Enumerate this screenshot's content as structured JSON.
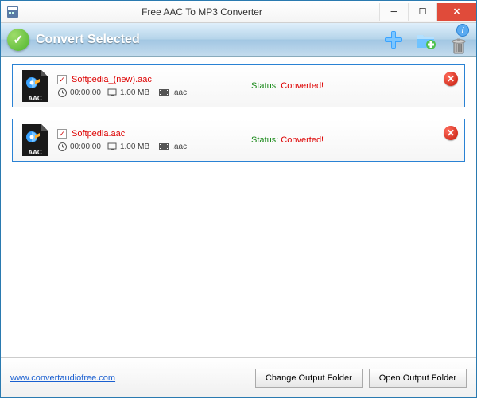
{
  "window": {
    "title": "Free AAC To MP3 Converter"
  },
  "toolbar": {
    "convert_label": "Convert Selected"
  },
  "files": [
    {
      "name": "Softpedia_(new).aac",
      "duration": "00:00:00",
      "size": "1.00 MB",
      "ext": ".aac",
      "status_label": "Status:",
      "status_value": " Converted!"
    },
    {
      "name": "Softpedia.aac",
      "duration": "00:00:00",
      "size": "1.00 MB",
      "ext": ".aac",
      "status_label": "Status:",
      "status_value": " Converted!"
    }
  ],
  "bottom": {
    "link": "www.convertaudiofree.com",
    "change_folder": "Change Output Folder",
    "open_folder": "Open Output Folder"
  }
}
